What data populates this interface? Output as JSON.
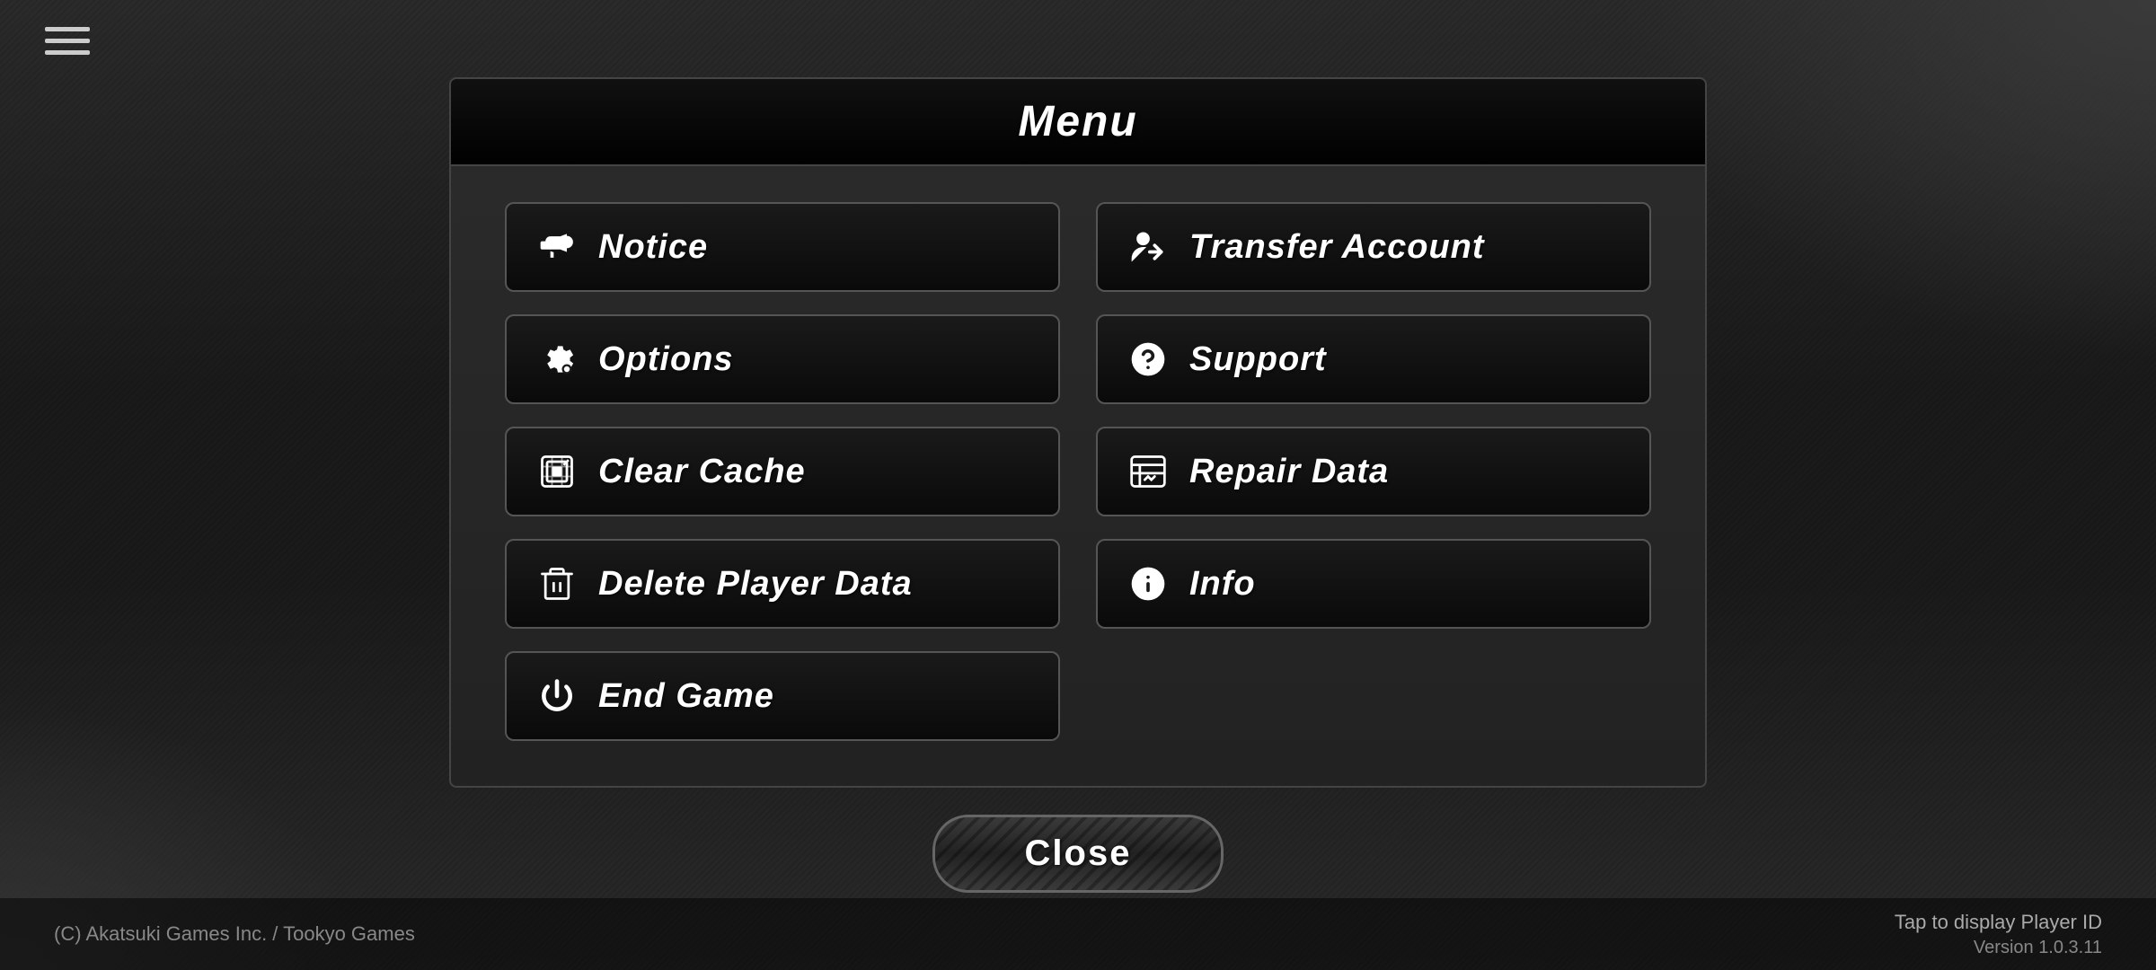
{
  "background": {
    "color": "#1a1a1a"
  },
  "hamburger": {
    "label": "Menu navigation"
  },
  "menu": {
    "title": "Menu",
    "buttons": {
      "row1": [
        {
          "id": "notice",
          "label": "Notice",
          "icon": "megaphone"
        },
        {
          "id": "transfer-account",
          "label": "Transfer Account",
          "icon": "transfer"
        }
      ],
      "row2": [
        {
          "id": "options",
          "label": "Options",
          "icon": "gear"
        },
        {
          "id": "support",
          "label": "Support",
          "icon": "question"
        }
      ],
      "row3": [
        {
          "id": "clear-cache",
          "label": "Clear Cache",
          "icon": "cache"
        },
        {
          "id": "repair-data",
          "label": "Repair Data",
          "icon": "repair"
        }
      ],
      "row4": [
        {
          "id": "delete-player-data",
          "label": "Delete Player Data",
          "icon": "trash"
        },
        {
          "id": "info",
          "label": "Info",
          "icon": "info"
        }
      ],
      "row5": [
        {
          "id": "end-game",
          "label": "End Game",
          "icon": "power"
        }
      ]
    },
    "close_label": "Close"
  },
  "footer": {
    "copyright": "(C) Akatsuki Games Inc. / Tookyo Games",
    "tap_player_id": "Tap to display Player ID",
    "version": "Version 1.0.3.11"
  }
}
